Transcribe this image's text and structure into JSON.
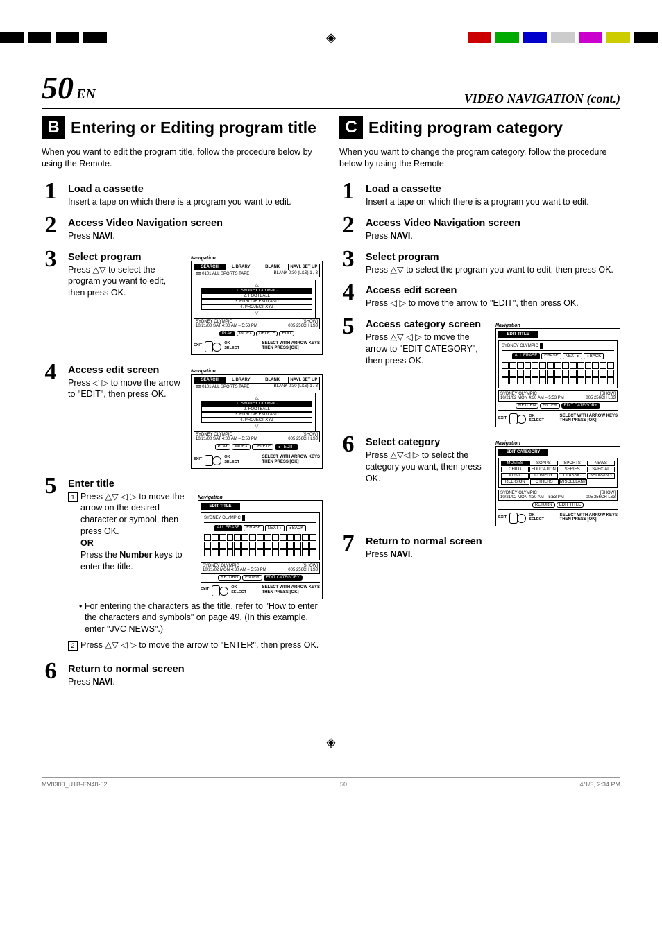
{
  "page": {
    "number": "50",
    "suffix": "EN",
    "section": "VIDEO NAVIGATION (cont.)"
  },
  "b": {
    "letter": "B",
    "title": "Entering or Editing program title",
    "intro": "When you want to edit the program title, follow the procedure below by using the Remote.",
    "s1": {
      "title": "Load a cassette",
      "text": "Insert a tape on which there is a program you want to edit."
    },
    "s2": {
      "title": "Access Video Navigation screen",
      "text_pre": "Press ",
      "text_bold": "NAVI",
      "text_post": "."
    },
    "s3": {
      "title": "Select program",
      "text": "Press △▽ to select the program you want to edit, then press OK."
    },
    "s4": {
      "title": "Access edit screen",
      "text": "Press ◁ ▷ to move the arrow to \"EDIT\", then press OK."
    },
    "s5": {
      "title": "Enter title",
      "sub1": "Press △▽ ◁ ▷ to move the arrow on the desired character or symbol, then press OK.",
      "or": "OR",
      "sub1b": "Press the Number keys to enter the title.",
      "bullet": "For entering the characters as the title, refer to \"How to enter the characters and symbols\" on page 49. (In this example, enter \"JVC NEWS\".)",
      "sub2": "Press △▽ ◁ ▷ to move the arrow to \"ENTER\", then press OK."
    },
    "s6": {
      "title": "Return to normal screen",
      "text_pre": "Press ",
      "text_bold": "NAVI",
      "text_post": "."
    }
  },
  "c": {
    "letter": "C",
    "title": "Editing program category",
    "intro": "When you want to change the program category, follow the procedure below by using the Remote.",
    "s1": {
      "title": "Load a cassette",
      "text": "Insert a tape on which there is a program you want to edit."
    },
    "s2": {
      "title": "Access Video Navigation screen",
      "text_pre": "Press ",
      "text_bold": "NAVI",
      "text_post": "."
    },
    "s3": {
      "title": "Select program",
      "text": "Press △▽ to select the program you want to edit, then press OK."
    },
    "s4": {
      "title": "Access edit screen",
      "text": "Press ◁ ▷ to move the arrow to \"EDIT\", then press OK."
    },
    "s5": {
      "title": "Access category screen",
      "text": "Press △▽ ◁ ▷ to move the arrow to \"EDIT CATEGORY\", then press OK."
    },
    "s6": {
      "title": "Select category",
      "text": "Press △▽◁ ▷ to select the category you want, then press OK."
    },
    "s7": {
      "title": "Return to normal screen",
      "text_pre": "Press ",
      "text_bold": "NAVI",
      "text_post": "."
    }
  },
  "screens": {
    "nav_label": "Navigation",
    "tabs": {
      "search": "SEARCH",
      "library": "LIBRARY",
      "blank": "BLANK",
      "setup": "NAVI. SET UP"
    },
    "tape_row": {
      "left": "0101 ALL SPORTS TAPE",
      "right": "BLANK 0:30 (L&S)   1 / 3"
    },
    "progs": {
      "p1": "1. SYDNEY OLYMPIC",
      "p2": "2. FOOTBALL",
      "p3": "3. EURO 96 ENGLAND",
      "p4": "4. PROJECT XYZ"
    },
    "info": {
      "left": "SYDNEY OLYMPIC\n10/21/00 SAT   4:00 AM – 5:53 PM",
      "right": "[SHOW]\n005 256CH    LS3"
    },
    "info2": {
      "left": "SYDNEY OLYMPIC\n10/21/02 MON   4:30 AM – 5:53 PM",
      "right": "[SHOW]\n005 256CH    LS3"
    },
    "btns": {
      "play": "PLAY",
      "index": "INDEX",
      "delete": "DELETE",
      "edit": "EDIT",
      "return": "RETURN",
      "enter": "ENTER",
      "editcat": "EDIT CATEGORY",
      "edittitle": "EDIT TITLE"
    },
    "footer": {
      "exit": "EXIT",
      "ok": "OK",
      "select": "SELECT",
      "instr1": "SELECT WITH ARROW KEYS",
      "instr2": "THEN PRESS [OK]"
    },
    "edit_title_tab": "EDIT TITLE",
    "edit_cat_tab": "EDIT CATEGORY",
    "title_value": "SYDNEY OLYMPIC",
    "title_btns": {
      "allerase": "ALL ERASE",
      "erase": "ERASE",
      "next": "NEXT ▸",
      "back": "◂ BACK"
    },
    "categories": {
      "r1": [
        "MOVIES",
        "SOAPS",
        "SPORTS",
        "NEWS"
      ],
      "r2": [
        "CHILD",
        "EDUCATION",
        "SERIES",
        "SPECIAL"
      ],
      "r3": [
        "MUSIC",
        "COMEDY",
        "CLASSIC",
        "SHOPPING"
      ],
      "r4": [
        "RELIGION",
        "OTHERS",
        "MISCELLANY",
        ""
      ]
    }
  },
  "footer_page": {
    "left": "MV8300_U1B-EN48-52",
    "center": "50",
    "right": "4/1/3, 2:34 PM"
  }
}
